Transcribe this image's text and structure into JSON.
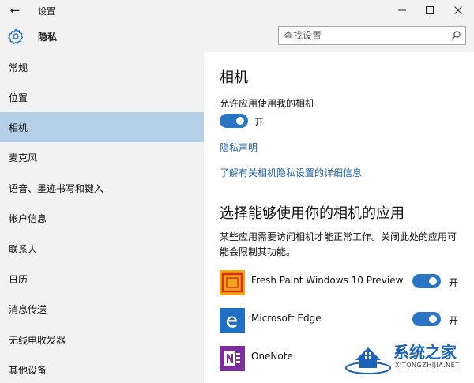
{
  "window": {
    "title": "设置",
    "back_glyph": "←",
    "controls": {
      "minimize": "—",
      "maximize": "☐",
      "close": "✕"
    }
  },
  "header": {
    "title": "隐私",
    "icon": "gear-icon",
    "search": {
      "placeholder": "查找设置",
      "value": "",
      "icon": "search-icon"
    }
  },
  "sidebar": {
    "selected_index": 2,
    "items": [
      {
        "label": "常规"
      },
      {
        "label": "位置"
      },
      {
        "label": "相机"
      },
      {
        "label": "麦克风"
      },
      {
        "label": "语音、墨迹书写和键入"
      },
      {
        "label": "帐户信息"
      },
      {
        "label": "联系人"
      },
      {
        "label": "日历"
      },
      {
        "label": "消息传送"
      },
      {
        "label": "无线电收发器"
      },
      {
        "label": "其他设备"
      }
    ]
  },
  "main": {
    "heading": "相机",
    "allow_label": "允许应用使用我的相机",
    "allow_toggle": {
      "on": true,
      "state_text": "开"
    },
    "privacy_link": "隐私声明",
    "details_link": "了解有关相机隐私设置的详细信息",
    "apps_heading": "选择能够使用你的相机的应用",
    "apps_description": "某些应用需要访问相机才能正常工作。关闭此处的应用可能会限制其功能。",
    "apps": [
      {
        "name": "Fresh Paint Windows 10 Preview",
        "icon": "fresh-paint-icon",
        "toggle_on": true,
        "state_text": "开"
      },
      {
        "name": "Microsoft Edge",
        "icon": "edge-icon",
        "toggle_on": true,
        "state_text": "开"
      },
      {
        "name": "OneNote",
        "icon": "onenote-icon"
      }
    ]
  },
  "watermark": {
    "title": "系统之家",
    "url": "XITONGZHIJIA.NET"
  },
  "colors": {
    "accent": "#2a74c4",
    "sidebar_bg": "#f2f2f2",
    "selected_bg": "#b6cfe8",
    "link": "#2464a8"
  }
}
